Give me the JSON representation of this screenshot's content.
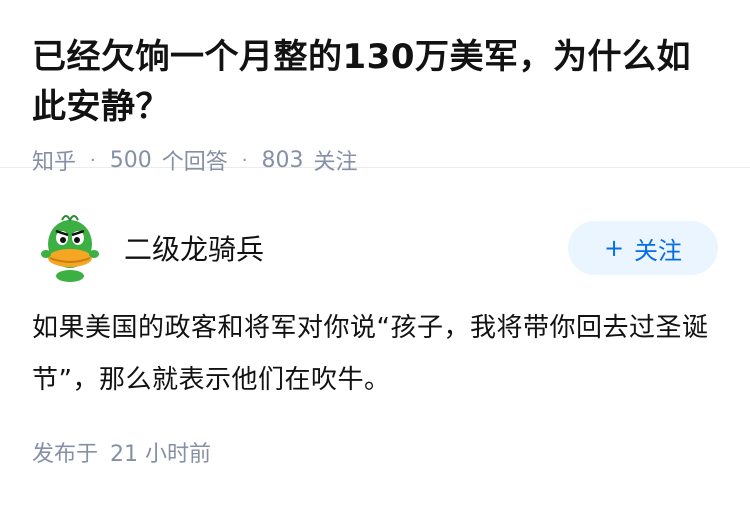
{
  "question": {
    "title": "已经欠饷一个月整的130万美军，为什么如此安静？",
    "site": "知乎",
    "answers_count": "500",
    "answers_label": "个回答",
    "follows_count": "803",
    "follows_label": "关注"
  },
  "answer": {
    "author_name": "二级龙骑兵",
    "follow_label": "关注",
    "content": "如果美国的政客和将军对你说“孩子，我将带你回去过圣诞节”，那么就表示他们在吹牛。",
    "posted_prefix": "发布于",
    "posted_time": "21 小时前"
  },
  "colors": {
    "accent": "#056de8",
    "follow_bg": "#ebf5ff",
    "meta": "#8590a6"
  }
}
